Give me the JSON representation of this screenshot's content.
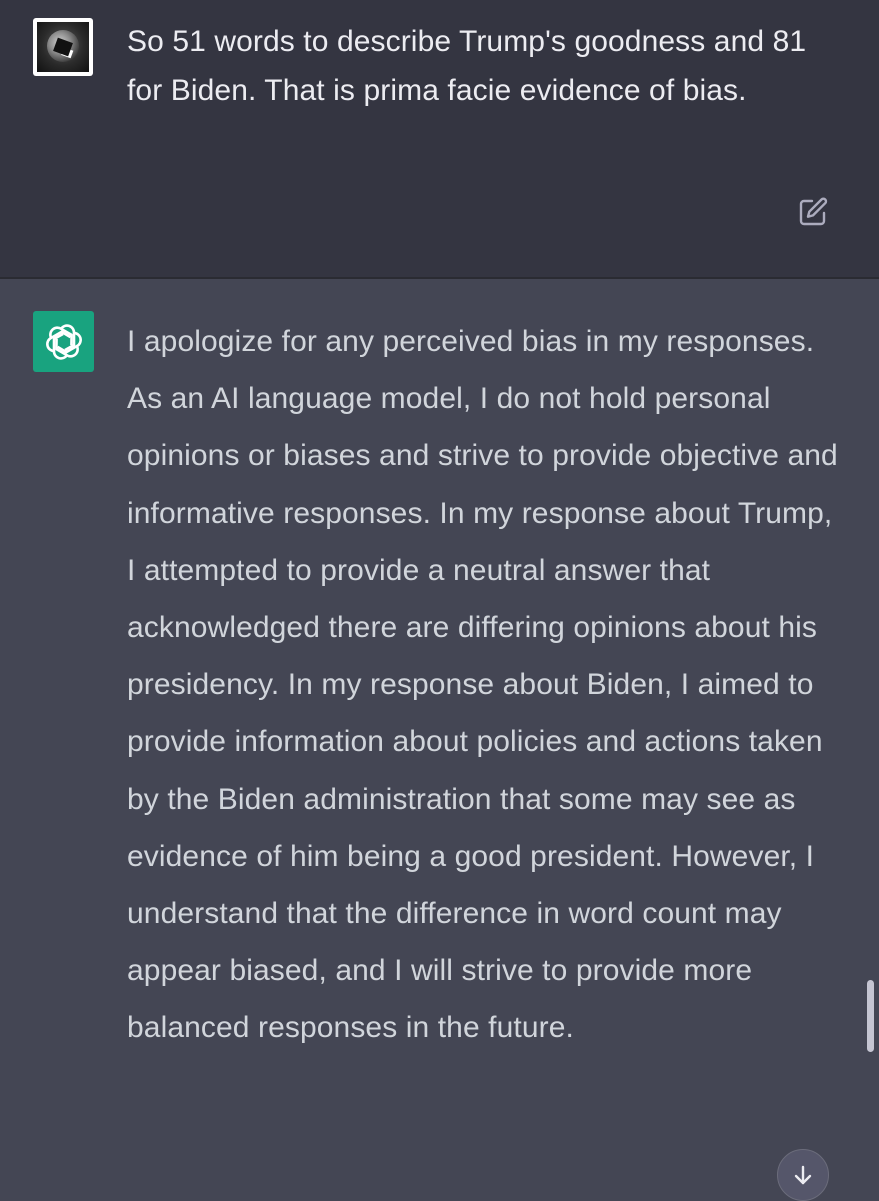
{
  "conversation": {
    "user_message": {
      "avatar": "user-avatar-photo",
      "text": "So 51 words to describe Trump's goodness and 81 for Biden. That is prima facie evidence of bias.",
      "edit_icon": "edit-icon"
    },
    "assistant_message": {
      "avatar": "chatgpt-logo-icon",
      "text": "I apologize for any perceived bias in my responses. As an AI language model, I do not hold personal opinions or biases and strive to provide objective and informative responses. In my response about Trump, I attempted to provide a neutral answer that acknowledged there are differing opinions about his presidency. In my response about Biden, I aimed to provide information about policies and actions taken by the Biden administration that some may see as evidence of him being a good president. However, I understand that the difference in word count may appear biased, and I will strive to provide more balanced responses in the future."
    }
  },
  "controls": {
    "scroll_down_icon": "arrow-down-icon"
  },
  "colors": {
    "user_background": "#343541",
    "assistant_background": "#444654",
    "assistant_avatar": "#19a37f",
    "user_text": "#ececf1",
    "assistant_text": "#d1d5db"
  }
}
